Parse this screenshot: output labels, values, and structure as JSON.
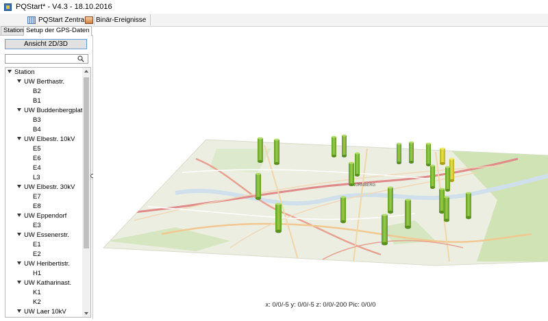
{
  "window": {
    "title": "PQStart* - V4.3 - 18.10.2016"
  },
  "toolbar": {
    "tabs": [
      {
        "label": "PQStart Zentrale",
        "icon": "grid-icon"
      },
      {
        "label": "Binär-Ereignisse",
        "icon": "binary-events-icon"
      }
    ]
  },
  "panel_tabs": [
    {
      "label": "Station",
      "active": false
    },
    {
      "label": "Setup der GPS-Daten",
      "active": true
    }
  ],
  "left_panel": {
    "view_button": "Ansicht 2D/3D",
    "search": {
      "value": "",
      "placeholder": ""
    }
  },
  "tree": {
    "root": "Station",
    "groups": [
      {
        "label": "UW Berthastr.",
        "children": [
          "B2",
          "B1"
        ]
      },
      {
        "label": "UW Buddenbergplatz",
        "children": [
          "B3",
          "B4"
        ]
      },
      {
        "label": "UW Elbestr. 10kV",
        "children": [
          "E5",
          "E6",
          "E4",
          "L3"
        ]
      },
      {
        "label": "UW Elbestr. 30kV",
        "children": [
          "E7",
          "E8"
        ]
      },
      {
        "label": "UW Eppendorf",
        "children": [
          "E3"
        ]
      },
      {
        "label": "UW Essenerstr.",
        "children": [
          "E1",
          "E2"
        ]
      },
      {
        "label": "UW Heribertistr.",
        "children": [
          "H1"
        ]
      },
      {
        "label": "UW Katharinast.",
        "children": [
          "K1",
          "K2"
        ]
      },
      {
        "label": "UW Laer 10kV",
        "children": []
      }
    ]
  },
  "map": {
    "city_label": "NÜRNBERG",
    "coords_text": "x: 0/0/-5 y: 0/0/-5 z: 0/0/-200 Pic: 0/0/0",
    "colors": {
      "green": "#7fb33a",
      "yellow": "#d9d23a",
      "pink": "#f5c2c8"
    }
  }
}
